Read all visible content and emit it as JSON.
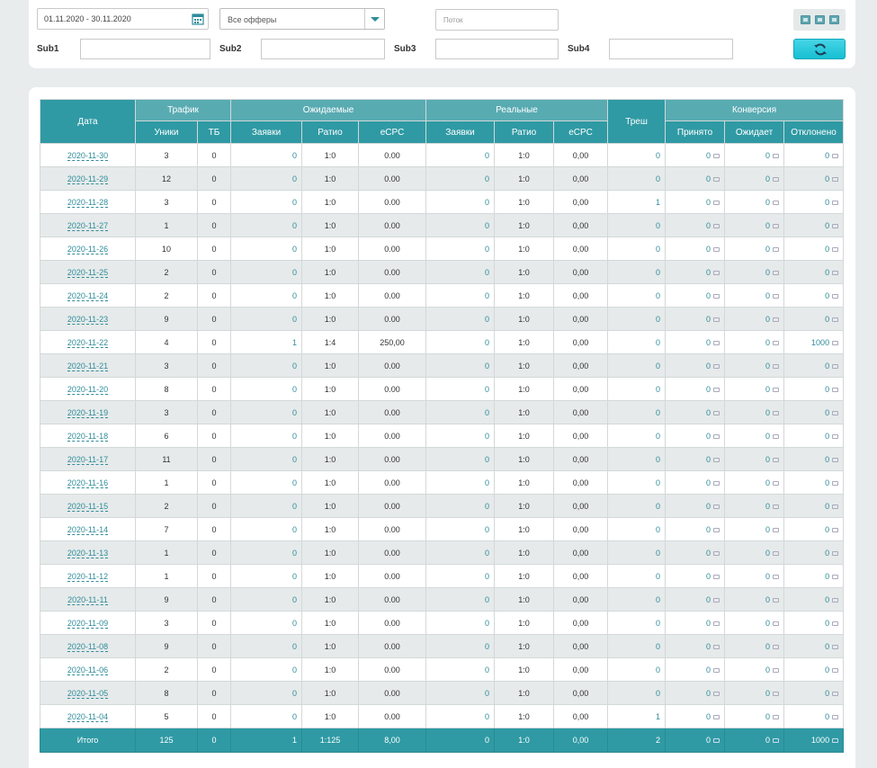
{
  "filters": {
    "date_range": "01.11.2020 - 30.11.2020",
    "offers_selected": "Все офферы",
    "stream_placeholder": "Поток",
    "sub1_label": "Sub1",
    "sub2_label": "Sub2",
    "sub3_label": "Sub3",
    "sub4_label": "Sub4"
  },
  "icons": {
    "calendar": "calendar-icon",
    "dropdown": "chevron-down-icon",
    "refresh": "refresh-icon",
    "export": "table-export-icon",
    "comment": "comment-icon"
  },
  "colors": {
    "header": "#59abb2",
    "header_dark": "#2f9aa4",
    "link": "#2f8c9a",
    "refresh_button": "#16bfd2"
  },
  "table": {
    "headers": {
      "date": "Дата",
      "traffic": "Трафик",
      "expected": "Ожидаемые",
      "real": "Реальные",
      "trash": "Треш",
      "conversion": "Конверсия",
      "uniques": "Уники",
      "tb": "ТБ",
      "exp_leads": "Заявки",
      "exp_ratio": "Ратио",
      "exp_ecpc": "eCPC",
      "real_leads": "Заявки",
      "real_ratio": "Ратио",
      "real_ecpc": "eCPC",
      "accepted": "Принято",
      "pending": "Ожидает",
      "rejected": "Отклонено"
    },
    "rows": [
      {
        "date": "2020-11-30",
        "uniques": "3",
        "tb": "0",
        "exp_leads": "0",
        "exp_ratio": "1:0",
        "exp_ecpc": "0.00",
        "real_leads": "0",
        "real_ratio": "1:0",
        "real_ecpc": "0,00",
        "trash": "0",
        "accepted": "0",
        "pending": "0",
        "rejected": "0"
      },
      {
        "date": "2020-11-29",
        "uniques": "12",
        "tb": "0",
        "exp_leads": "0",
        "exp_ratio": "1:0",
        "exp_ecpc": "0.00",
        "real_leads": "0",
        "real_ratio": "1:0",
        "real_ecpc": "0,00",
        "trash": "0",
        "accepted": "0",
        "pending": "0",
        "rejected": "0"
      },
      {
        "date": "2020-11-28",
        "uniques": "3",
        "tb": "0",
        "exp_leads": "0",
        "exp_ratio": "1:0",
        "exp_ecpc": "0.00",
        "real_leads": "0",
        "real_ratio": "1:0",
        "real_ecpc": "0,00",
        "trash": "1",
        "accepted": "0",
        "pending": "0",
        "rejected": "0"
      },
      {
        "date": "2020-11-27",
        "uniques": "1",
        "tb": "0",
        "exp_leads": "0",
        "exp_ratio": "1:0",
        "exp_ecpc": "0.00",
        "real_leads": "0",
        "real_ratio": "1:0",
        "real_ecpc": "0,00",
        "trash": "0",
        "accepted": "0",
        "pending": "0",
        "rejected": "0"
      },
      {
        "date": "2020-11-26",
        "uniques": "10",
        "tb": "0",
        "exp_leads": "0",
        "exp_ratio": "1:0",
        "exp_ecpc": "0.00",
        "real_leads": "0",
        "real_ratio": "1:0",
        "real_ecpc": "0,00",
        "trash": "0",
        "accepted": "0",
        "pending": "0",
        "rejected": "0"
      },
      {
        "date": "2020-11-25",
        "uniques": "2",
        "tb": "0",
        "exp_leads": "0",
        "exp_ratio": "1:0",
        "exp_ecpc": "0.00",
        "real_leads": "0",
        "real_ratio": "1:0",
        "real_ecpc": "0,00",
        "trash": "0",
        "accepted": "0",
        "pending": "0",
        "rejected": "0"
      },
      {
        "date": "2020-11-24",
        "uniques": "2",
        "tb": "0",
        "exp_leads": "0",
        "exp_ratio": "1:0",
        "exp_ecpc": "0.00",
        "real_leads": "0",
        "real_ratio": "1:0",
        "real_ecpc": "0,00",
        "trash": "0",
        "accepted": "0",
        "pending": "0",
        "rejected": "0"
      },
      {
        "date": "2020-11-23",
        "uniques": "9",
        "tb": "0",
        "exp_leads": "0",
        "exp_ratio": "1:0",
        "exp_ecpc": "0.00",
        "real_leads": "0",
        "real_ratio": "1:0",
        "real_ecpc": "0,00",
        "trash": "0",
        "accepted": "0",
        "pending": "0",
        "rejected": "0"
      },
      {
        "date": "2020-11-22",
        "uniques": "4",
        "tb": "0",
        "exp_leads": "1",
        "exp_ratio": "1:4",
        "exp_ecpc": "250,00",
        "real_leads": "0",
        "real_ratio": "1:0",
        "real_ecpc": "0,00",
        "trash": "0",
        "accepted": "0",
        "pending": "0",
        "rejected": "1000"
      },
      {
        "date": "2020-11-21",
        "uniques": "3",
        "tb": "0",
        "exp_leads": "0",
        "exp_ratio": "1:0",
        "exp_ecpc": "0.00",
        "real_leads": "0",
        "real_ratio": "1:0",
        "real_ecpc": "0,00",
        "trash": "0",
        "accepted": "0",
        "pending": "0",
        "rejected": "0"
      },
      {
        "date": "2020-11-20",
        "uniques": "8",
        "tb": "0",
        "exp_leads": "0",
        "exp_ratio": "1:0",
        "exp_ecpc": "0.00",
        "real_leads": "0",
        "real_ratio": "1:0",
        "real_ecpc": "0,00",
        "trash": "0",
        "accepted": "0",
        "pending": "0",
        "rejected": "0"
      },
      {
        "date": "2020-11-19",
        "uniques": "3",
        "tb": "0",
        "exp_leads": "0",
        "exp_ratio": "1:0",
        "exp_ecpc": "0.00",
        "real_leads": "0",
        "real_ratio": "1:0",
        "real_ecpc": "0,00",
        "trash": "0",
        "accepted": "0",
        "pending": "0",
        "rejected": "0"
      },
      {
        "date": "2020-11-18",
        "uniques": "6",
        "tb": "0",
        "exp_leads": "0",
        "exp_ratio": "1:0",
        "exp_ecpc": "0.00",
        "real_leads": "0",
        "real_ratio": "1:0",
        "real_ecpc": "0,00",
        "trash": "0",
        "accepted": "0",
        "pending": "0",
        "rejected": "0"
      },
      {
        "date": "2020-11-17",
        "uniques": "11",
        "tb": "0",
        "exp_leads": "0",
        "exp_ratio": "1:0",
        "exp_ecpc": "0.00",
        "real_leads": "0",
        "real_ratio": "1:0",
        "real_ecpc": "0,00",
        "trash": "0",
        "accepted": "0",
        "pending": "0",
        "rejected": "0"
      },
      {
        "date": "2020-11-16",
        "uniques": "1",
        "tb": "0",
        "exp_leads": "0",
        "exp_ratio": "1:0",
        "exp_ecpc": "0.00",
        "real_leads": "0",
        "real_ratio": "1:0",
        "real_ecpc": "0,00",
        "trash": "0",
        "accepted": "0",
        "pending": "0",
        "rejected": "0"
      },
      {
        "date": "2020-11-15",
        "uniques": "2",
        "tb": "0",
        "exp_leads": "0",
        "exp_ratio": "1:0",
        "exp_ecpc": "0.00",
        "real_leads": "0",
        "real_ratio": "1:0",
        "real_ecpc": "0,00",
        "trash": "0",
        "accepted": "0",
        "pending": "0",
        "rejected": "0"
      },
      {
        "date": "2020-11-14",
        "uniques": "7",
        "tb": "0",
        "exp_leads": "0",
        "exp_ratio": "1:0",
        "exp_ecpc": "0.00",
        "real_leads": "0",
        "real_ratio": "1:0",
        "real_ecpc": "0,00",
        "trash": "0",
        "accepted": "0",
        "pending": "0",
        "rejected": "0"
      },
      {
        "date": "2020-11-13",
        "uniques": "1",
        "tb": "0",
        "exp_leads": "0",
        "exp_ratio": "1:0",
        "exp_ecpc": "0.00",
        "real_leads": "0",
        "real_ratio": "1:0",
        "real_ecpc": "0,00",
        "trash": "0",
        "accepted": "0",
        "pending": "0",
        "rejected": "0"
      },
      {
        "date": "2020-11-12",
        "uniques": "1",
        "tb": "0",
        "exp_leads": "0",
        "exp_ratio": "1:0",
        "exp_ecpc": "0.00",
        "real_leads": "0",
        "real_ratio": "1:0",
        "real_ecpc": "0,00",
        "trash": "0",
        "accepted": "0",
        "pending": "0",
        "rejected": "0"
      },
      {
        "date": "2020-11-11",
        "uniques": "9",
        "tb": "0",
        "exp_leads": "0",
        "exp_ratio": "1:0",
        "exp_ecpc": "0.00",
        "real_leads": "0",
        "real_ratio": "1:0",
        "real_ecpc": "0,00",
        "trash": "0",
        "accepted": "0",
        "pending": "0",
        "rejected": "0"
      },
      {
        "date": "2020-11-09",
        "uniques": "3",
        "tb": "0",
        "exp_leads": "0",
        "exp_ratio": "1:0",
        "exp_ecpc": "0.00",
        "real_leads": "0",
        "real_ratio": "1:0",
        "real_ecpc": "0,00",
        "trash": "0",
        "accepted": "0",
        "pending": "0",
        "rejected": "0"
      },
      {
        "date": "2020-11-08",
        "uniques": "9",
        "tb": "0",
        "exp_leads": "0",
        "exp_ratio": "1:0",
        "exp_ecpc": "0.00",
        "real_leads": "0",
        "real_ratio": "1:0",
        "real_ecpc": "0,00",
        "trash": "0",
        "accepted": "0",
        "pending": "0",
        "rejected": "0"
      },
      {
        "date": "2020-11-06",
        "uniques": "2",
        "tb": "0",
        "exp_leads": "0",
        "exp_ratio": "1:0",
        "exp_ecpc": "0.00",
        "real_leads": "0",
        "real_ratio": "1:0",
        "real_ecpc": "0,00",
        "trash": "0",
        "accepted": "0",
        "pending": "0",
        "rejected": "0"
      },
      {
        "date": "2020-11-05",
        "uniques": "8",
        "tb": "0",
        "exp_leads": "0",
        "exp_ratio": "1:0",
        "exp_ecpc": "0.00",
        "real_leads": "0",
        "real_ratio": "1:0",
        "real_ecpc": "0,00",
        "trash": "0",
        "accepted": "0",
        "pending": "0",
        "rejected": "0"
      },
      {
        "date": "2020-11-04",
        "uniques": "5",
        "tb": "0",
        "exp_leads": "0",
        "exp_ratio": "1:0",
        "exp_ecpc": "0.00",
        "real_leads": "0",
        "real_ratio": "1:0",
        "real_ecpc": "0,00",
        "trash": "1",
        "accepted": "0",
        "pending": "0",
        "rejected": "0"
      }
    ],
    "totals": {
      "label": "Итого",
      "uniques": "125",
      "tb": "0",
      "exp_leads": "1",
      "exp_ratio": "1:125",
      "exp_ecpc": "8,00",
      "real_leads": "0",
      "real_ratio": "1:0",
      "real_ecpc": "0,00",
      "trash": "2",
      "accepted": "0",
      "pending": "0",
      "rejected": "1000"
    }
  }
}
